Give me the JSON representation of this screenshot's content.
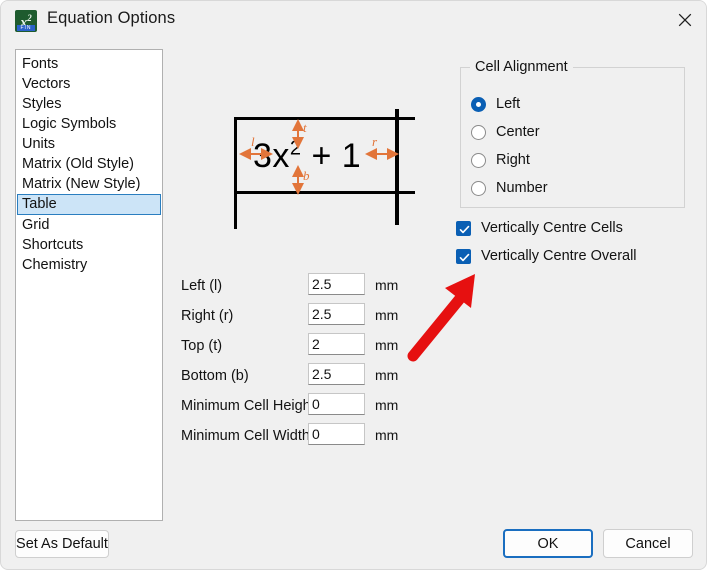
{
  "window": {
    "title": "Equation Options",
    "icon": "equation-app-icon",
    "icon_glyph": "x",
    "icon_badge": "FIN",
    "close_icon": "close-icon"
  },
  "categories": {
    "name": "category-list",
    "items": [
      "Fonts",
      "Vectors",
      "Styles",
      "Logic Symbols",
      "Units",
      "Matrix (Old Style)",
      "Matrix (New Style)",
      "Table",
      "Grid",
      "Shortcuts",
      "Chemistry"
    ],
    "selected": "Table"
  },
  "preview": {
    "equation_base": "3x",
    "equation_exp": "2",
    "equation_tail": " + 1",
    "markers": {
      "left": "l",
      "right": "r",
      "top": "t",
      "bottom": "b"
    },
    "marker_color": "#e2753a"
  },
  "measurements": {
    "unit": "mm",
    "fields": [
      {
        "label": "Left (l)",
        "value": "2.5",
        "unit": "mm"
      },
      {
        "label": "Right (r)",
        "value": "2.5",
        "unit": "mm"
      },
      {
        "label": "Top (t)",
        "value": "2",
        "unit": "mm"
      },
      {
        "label": "Bottom (b)",
        "value": "2.5",
        "unit": "mm"
      },
      {
        "label": "Minimum Cell Height",
        "value": "0",
        "unit": "mm"
      },
      {
        "label": "Minimum Cell Width",
        "value": "0",
        "unit": "mm"
      }
    ]
  },
  "cell_alignment": {
    "legend": "Cell Alignment",
    "options": [
      {
        "label": "Left",
        "checked": true
      },
      {
        "label": "Center",
        "checked": false
      },
      {
        "label": "Right",
        "checked": false
      },
      {
        "label": "Number",
        "checked": false
      }
    ]
  },
  "checkboxes": [
    {
      "label": "Vertically Centre Cells",
      "checked": true
    },
    {
      "label": "Vertically Centre Overall",
      "checked": true
    }
  ],
  "annotation": {
    "type": "red-arrow",
    "color": "#e61010",
    "points_to": "Vertically Centre Overall"
  },
  "footer": {
    "set_default_label": "Set As Default",
    "ok_label": "OK",
    "cancel_label": "Cancel"
  },
  "colors": {
    "dialog_bg": "#f0f0f0",
    "accent": "#0a5fb4",
    "selection_bg": "#cce4f7",
    "selection_border": "#2a7ec0",
    "annotation_red": "#e61010",
    "marker_orange": "#e2753a"
  }
}
